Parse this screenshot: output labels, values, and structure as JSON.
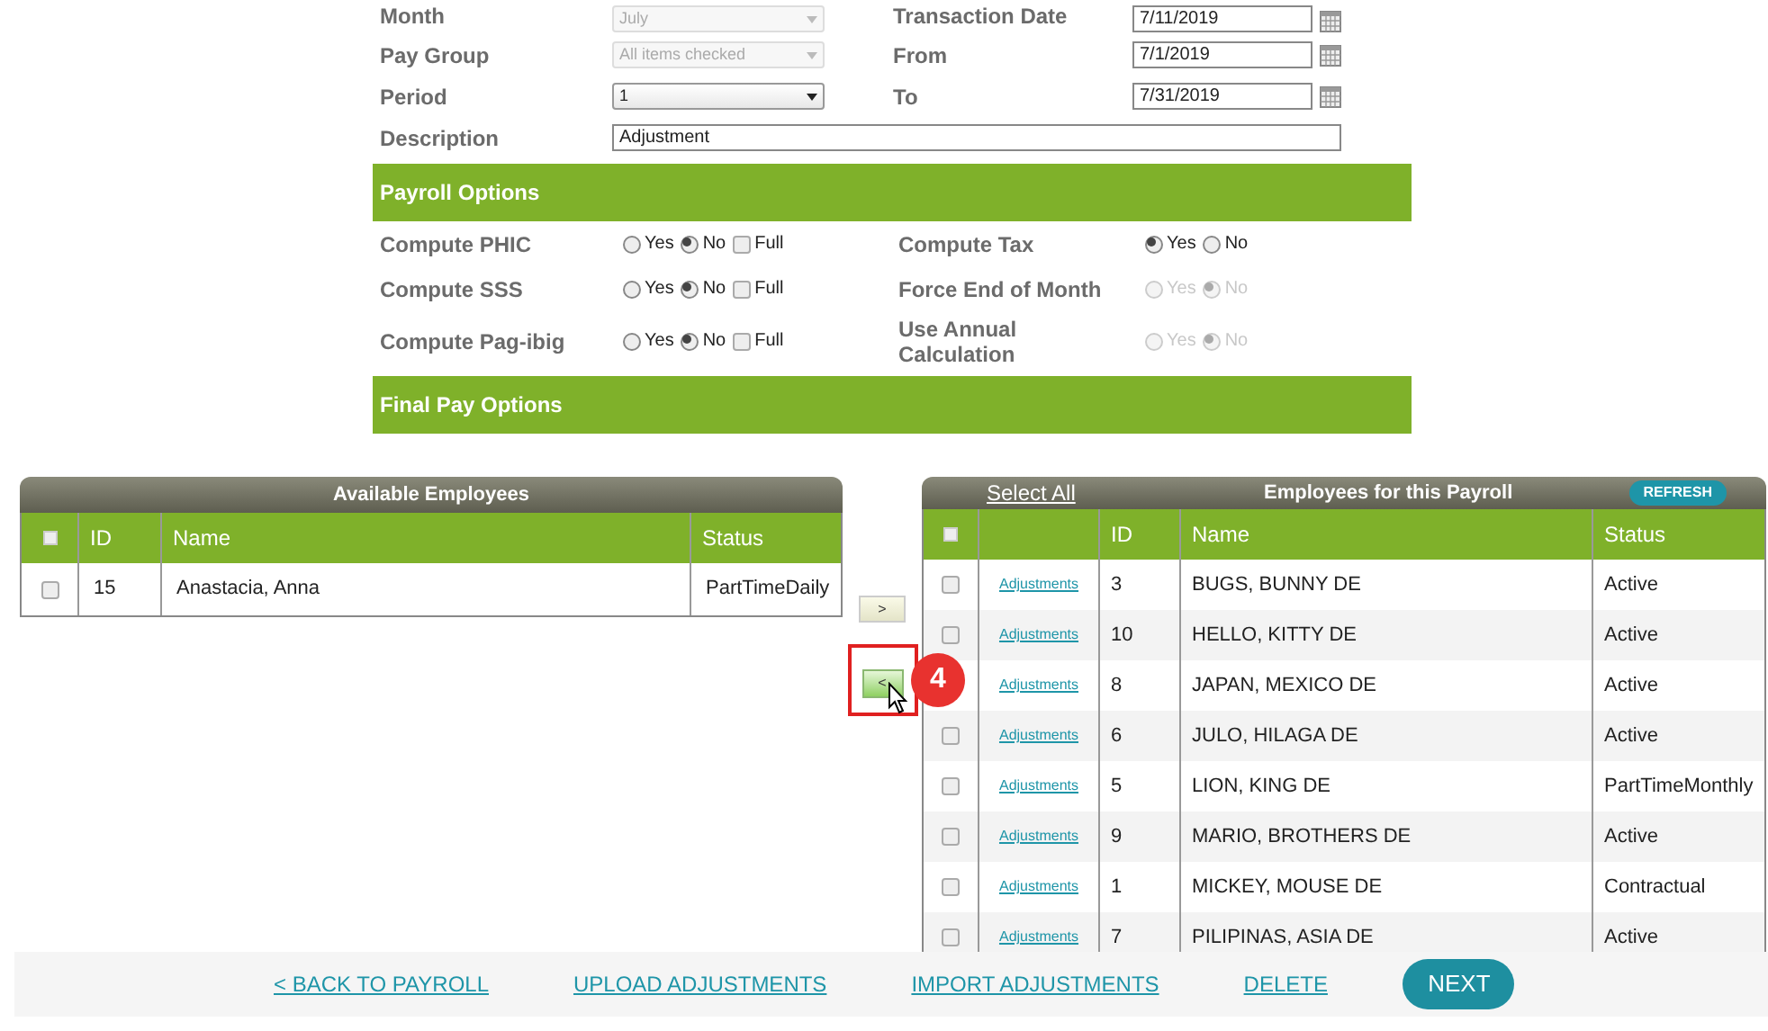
{
  "form": {
    "fields": [
      {
        "label": "Month",
        "kind": "select",
        "value": "July",
        "disabled": true,
        "right_label": "Transaction Date",
        "right_value": "7/11/2019"
      },
      {
        "label": "Pay Group",
        "kind": "select",
        "value": "All items checked",
        "disabled": true,
        "right_label": "From",
        "right_value": "7/1/2019"
      },
      {
        "label": "Period",
        "kind": "select",
        "value": "1",
        "disabled": false,
        "right_label": "To",
        "right_value": "7/31/2019"
      },
      {
        "label": "Description",
        "kind": "text",
        "value": "Adjustment"
      }
    ]
  },
  "payroll_options": {
    "title": "Payroll Options",
    "rows": [
      {
        "left": {
          "label": "Compute PHIC",
          "options": [
            {
              "label": "Yes",
              "selected": false
            },
            {
              "label": "No",
              "selected": true
            }
          ],
          "full": {
            "label": "Full",
            "checked": false
          }
        },
        "right": {
          "label": "Compute Tax",
          "disabled": false,
          "options": [
            {
              "label": "Yes",
              "selected": true
            },
            {
              "label": "No",
              "selected": false
            }
          ]
        }
      },
      {
        "left": {
          "label": "Compute SSS",
          "options": [
            {
              "label": "Yes",
              "selected": false
            },
            {
              "label": "No",
              "selected": true
            }
          ],
          "full": {
            "label": "Full",
            "checked": false
          }
        },
        "right": {
          "label": "Force End of Month",
          "disabled": true,
          "options": [
            {
              "label": "Yes",
              "selected": false
            },
            {
              "label": "No",
              "selected": true
            }
          ]
        }
      },
      {
        "left": {
          "label": "Compute Pag-ibig",
          "options": [
            {
              "label": "Yes",
              "selected": false
            },
            {
              "label": "No",
              "selected": true
            }
          ],
          "full": {
            "label": "Full",
            "checked": false
          }
        },
        "right": {
          "label": "Use Annual Calculation",
          "disabled": true,
          "options": [
            {
              "label": "Yes",
              "selected": false
            },
            {
              "label": "No",
              "selected": true
            }
          ]
        }
      }
    ]
  },
  "final_pay_options": {
    "title": "Final Pay Options"
  },
  "available_employees": {
    "title": "Available Employees",
    "all_checked": false,
    "columns": [
      "ID",
      "Name",
      "Status"
    ],
    "rows": [
      {
        "checked": false,
        "id": "15",
        "name": "Anastacia, Anna",
        "status": "PartTimeDaily"
      }
    ]
  },
  "move_buttons": [
    {
      "label": ">",
      "highlighted": false
    },
    {
      "label": "<",
      "highlighted": true
    }
  ],
  "step_badge": "4",
  "payroll_employees": {
    "select_all": "Select All",
    "title": "Employees for this Payroll",
    "refresh": "REFRESH",
    "all_checked": false,
    "columns": [
      "ID",
      "Name",
      "Status"
    ],
    "rows": [
      {
        "checked": false,
        "link": "Adjustments",
        "id": "3",
        "name": "BUGS, BUNNY DE",
        "status": "Active"
      },
      {
        "checked": false,
        "link": "Adjustments",
        "id": "10",
        "name": "HELLO, KITTY DE",
        "status": "Active"
      },
      {
        "link": "Adjustments",
        "id": "8",
        "name": "JAPAN, MEXICO DE",
        "status": "Active"
      },
      {
        "checked": false,
        "link": "Adjustments",
        "id": "6",
        "name": "JULO, HILAGA DE",
        "status": "Active"
      },
      {
        "checked": false,
        "link": "Adjustments",
        "id": "5",
        "name": "LION, KING DE",
        "status": "PartTimeMonthly"
      },
      {
        "checked": false,
        "link": "Adjustments",
        "id": "9",
        "name": "MARIO, BROTHERS DE",
        "status": "Active"
      },
      {
        "checked": false,
        "link": "Adjustments",
        "id": "1",
        "name": "MICKEY, MOUSE DE",
        "status": "Contractual"
      },
      {
        "checked": false,
        "link": "Adjustments",
        "id": "7",
        "name": "PILIPINAS, ASIA DE",
        "status": "Active"
      }
    ]
  },
  "footer": {
    "links": [
      "< BACK TO PAYROLL",
      "UPLOAD ADJUSTMENTS",
      "IMPORT ADJUSTMENTS",
      "DELETE"
    ],
    "primary": "NEXT"
  }
}
